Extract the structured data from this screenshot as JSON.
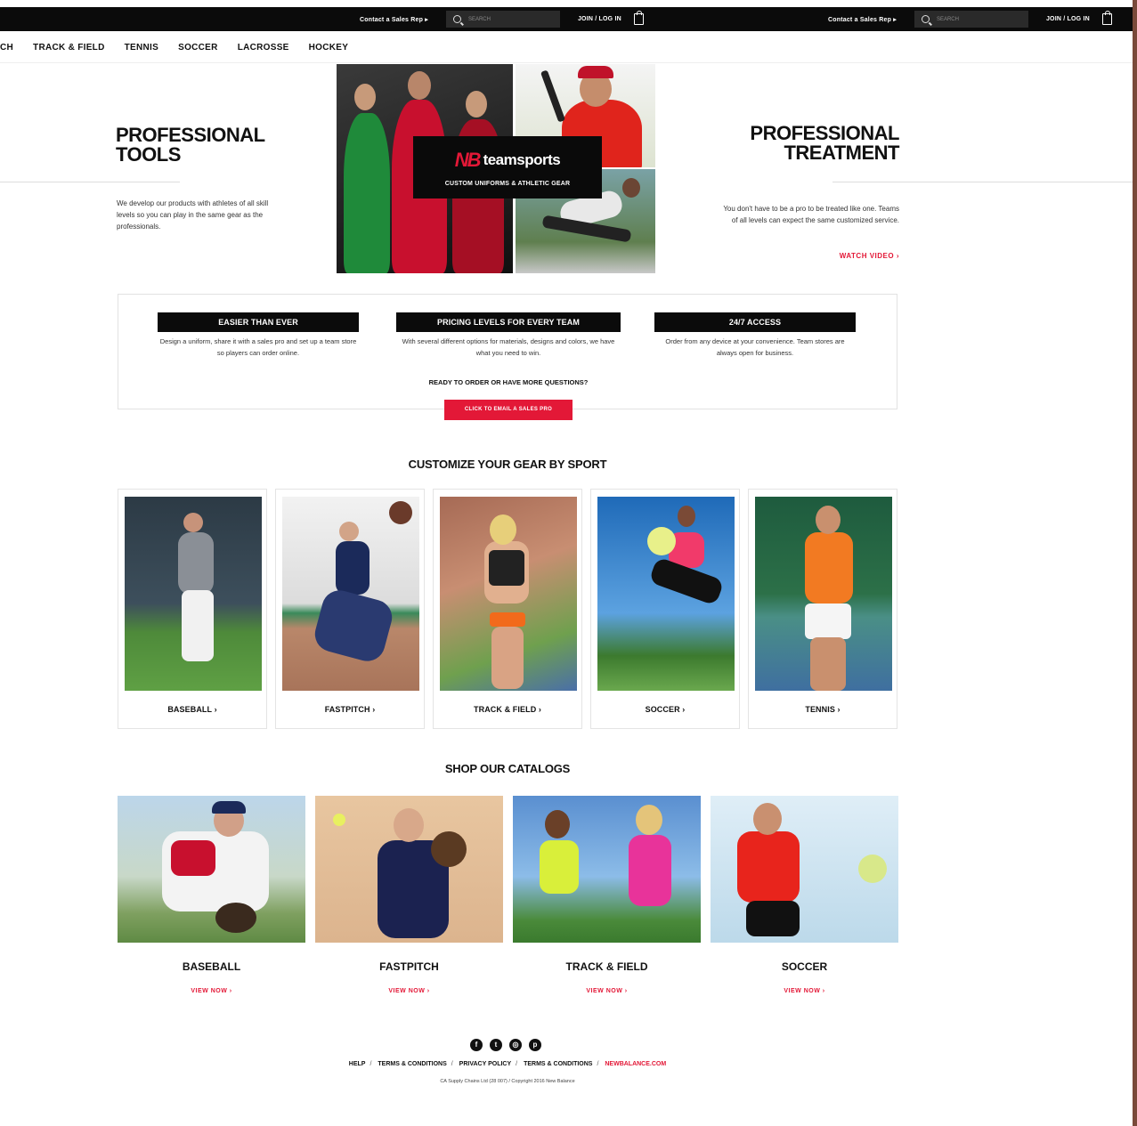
{
  "topbar": {
    "contact": "Contact a Sales Rep ▸",
    "search_placeholder": "SEARCH",
    "join": "JOIN / LOG IN"
  },
  "nav": {
    "items": [
      "CH",
      "TRACK & FIELD",
      "TENNIS",
      "SOCCER",
      "LACROSSE",
      "HOCKEY"
    ]
  },
  "hero": {
    "left_title_1": "PROFESSIONAL",
    "left_title_2": "TOOLS",
    "left_text": "We develop our products with athletes of all skill levels so you can play in the same gear as the professionals.",
    "right_title_1": "PROFESSIONAL",
    "right_title_2": "TREATMENT",
    "right_text": "You don't have to be a pro to be treated like one. Teams of all levels can expect the same customized service.",
    "watch_video": "WATCH VIDEO ›",
    "logo_mark": "NB",
    "logo_text": "teamsports",
    "logo_sub": "CUSTOM UNIFORMS & ATHLETIC GEAR"
  },
  "features": {
    "items": [
      {
        "title": "EASIER THAN EVER",
        "text": "Design a uniform, share it with a sales pro and set up a team store so players can order online."
      },
      {
        "title": "PRICING LEVELS FOR EVERY TEAM",
        "text": "With several different options for materials, designs and colors, we have what you need to win."
      },
      {
        "title": "24/7 ACCESS",
        "text": "Order from any device at your convenience. Team stores are always open for business."
      }
    ],
    "ready": "READY TO ORDER OR HAVE MORE QUESTIONS?",
    "email_button": "CLICK TO EMAIL A SALES PRO"
  },
  "customize": {
    "title": "CUSTOMIZE YOUR GEAR BY SPORT",
    "sports": [
      "BASEBALL ›",
      "FASTPITCH ›",
      "TRACK & FIELD ›",
      "SOCCER ›",
      "TENNIS ›"
    ]
  },
  "catalogs": {
    "title": "SHOP OUR CATALOGS",
    "items": [
      {
        "name": "BASEBALL",
        "link": "VIEW NOW ›"
      },
      {
        "name": "FASTPITCH",
        "link": "VIEW NOW ›"
      },
      {
        "name": "TRACK & FIELD",
        "link": "VIEW NOW ›"
      },
      {
        "name": "SOCCER",
        "link": "VIEW NOW ›"
      }
    ]
  },
  "footer": {
    "social_icons": [
      "facebook-icon",
      "twitter-icon",
      "instagram-icon",
      "pinterest-icon"
    ],
    "links": [
      "HELP",
      "TERMS & CONDITIONS",
      "PRIVACY POLICY",
      "TERMS & CONDITIONS",
      "NEWBALANCE.COM"
    ],
    "copyright": "CA Supply Chains Ltd (28 007) / Copyright 2016 New Balance"
  },
  "colors": {
    "accent": "#e31837",
    "dark": "#0b0b0b"
  }
}
